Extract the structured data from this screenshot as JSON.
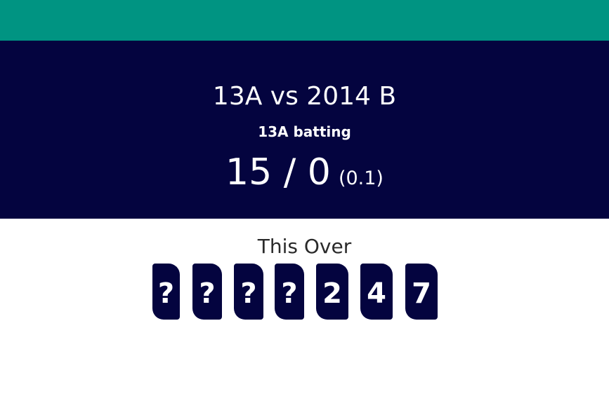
{
  "colors": {
    "top_bar": "#009482",
    "panel": "#04043f",
    "ball": "#04043f"
  },
  "match": {
    "title": "13A vs 2014 B",
    "batting": "13A batting",
    "score": "15 / 0",
    "overs": "(0.1)"
  },
  "this_over": {
    "heading": "This Over",
    "balls": [
      "?",
      "?",
      "?",
      "?",
      "2",
      "4",
      "7"
    ]
  }
}
